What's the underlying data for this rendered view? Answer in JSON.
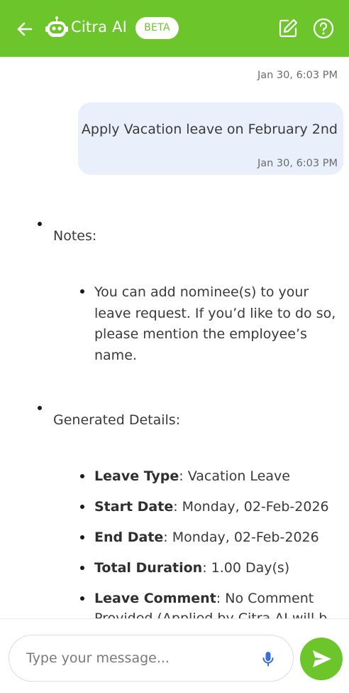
{
  "header": {
    "title": "Citra AI",
    "badge": "BETA",
    "icons": {
      "back": "arrow-left-icon",
      "logo": "robot-icon",
      "edit": "edit-icon",
      "help": "help-icon"
    }
  },
  "colors": {
    "brand": "#6cc52b",
    "user_bubble": "#e9f0fb"
  },
  "chat": {
    "timestamp_top": "Jan 30, 6:03 PM",
    "user_message": {
      "text": "Apply Vacation leave on February 2nd",
      "timestamp": "Jan 30, 6:03 PM"
    },
    "bot_reply": {
      "notes_label": "Notes:",
      "notes_items": [
        "You can add nominee(s) to your leave request. If you’d like to do so, please mention the employee’s name."
      ],
      "details_label": "Generated Details:",
      "details": [
        {
          "label": "Leave Type",
          "value": ": Vacation Leave"
        },
        {
          "label": "Start Date",
          "value": ": Monday, 02-Feb-2026"
        },
        {
          "label": "End Date",
          "value": ": Monday, 02-Feb-2026"
        },
        {
          "label": "Total Duration",
          "value": ": 1.00 Day(s)"
        },
        {
          "label": "Leave Comment",
          "value": ": No Comment"
        }
      ],
      "cut_off_line": "Provided (Applied by Citra AI will b"
    }
  },
  "composer": {
    "placeholder": "Type your message...",
    "icons": {
      "mic": "microphone-icon",
      "send": "send-icon"
    }
  }
}
